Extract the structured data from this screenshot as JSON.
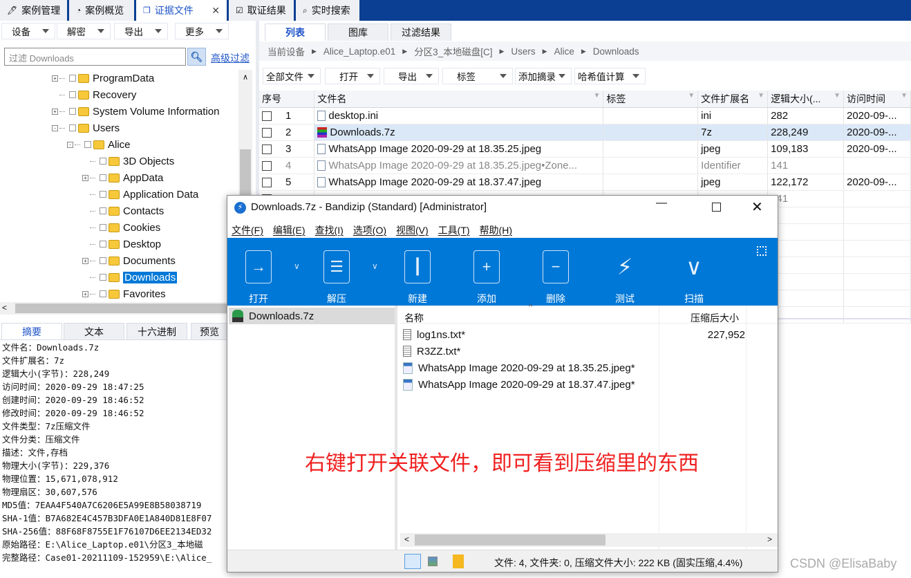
{
  "top_tabs": [
    {
      "label": "案例管理",
      "icon": "edit-icon"
    },
    {
      "label": "案例概览",
      "icon": "pie-icon"
    },
    {
      "label": "证据文件",
      "icon": "files-icon",
      "active": true
    },
    {
      "label": "取证结果",
      "icon": "checklist-icon"
    },
    {
      "label": "实时搜索",
      "icon": "search-icon"
    }
  ],
  "left_toolbar": [
    "设备",
    "解密",
    "导出",
    "更多"
  ],
  "filter": {
    "placeholder": "过滤 Downloads",
    "advanced": "高级过滤"
  },
  "tree": [
    {
      "label": "ProgramData",
      "exp": "+"
    },
    {
      "label": "Recovery",
      "exp": ""
    },
    {
      "label": "System Volume Information",
      "exp": "+"
    },
    {
      "label": "Users",
      "exp": "-"
    },
    {
      "label": "Alice",
      "exp": "-"
    },
    {
      "label": "3D Objects",
      "exp": ""
    },
    {
      "label": "AppData",
      "exp": "+"
    },
    {
      "label": "Application Data",
      "exp": ""
    },
    {
      "label": "Contacts",
      "exp": ""
    },
    {
      "label": "Cookies",
      "exp": ""
    },
    {
      "label": "Desktop",
      "exp": ""
    },
    {
      "label": "Documents",
      "exp": "+"
    },
    {
      "label": "Downloads",
      "exp": "",
      "selected": true
    },
    {
      "label": "Favorites",
      "exp": "+"
    }
  ],
  "right_tabs": [
    "列表",
    "图库",
    "过滤结果"
  ],
  "breadcrumb": [
    "当前设备",
    "Alice_Laptop.e01",
    "分区3_本地磁盘[C]",
    "Users",
    "Alice",
    "Downloads"
  ],
  "right_toolbar": [
    "全部文件",
    "打开",
    "导出",
    "标签",
    "添加摘录",
    "哈希值计算"
  ],
  "table": {
    "headers": [
      "序号",
      "文件名",
      "标签",
      "文件扩展名",
      "逻辑大小(...",
      "访问时间"
    ],
    "rows": [
      {
        "n": "1",
        "name": "desktop.ini",
        "tag": "",
        "ext": "ini",
        "size": "282",
        "time": "2020-09-..."
      },
      {
        "n": "2",
        "name": "Downloads.7z",
        "tag": "",
        "ext": "7z",
        "size": "228,249",
        "time": "2020-09-...",
        "selected": true
      },
      {
        "n": "3",
        "name": "WhatsApp Image 2020-09-29 at 18.35.25.jpeg",
        "tag": "",
        "ext": "jpeg",
        "size": "109,183",
        "time": "2020-09-..."
      },
      {
        "n": "4",
        "name": "WhatsApp Image 2020-09-29 at 18.35.25.jpeg•Zone...",
        "tag": "",
        "ext": "Identifier",
        "size": "141",
        "time": "",
        "dim": true
      },
      {
        "n": "5",
        "name": "WhatsApp Image 2020-09-29 at 18.37.47.jpeg",
        "tag": "",
        "ext": "jpeg",
        "size": "122,172",
        "time": "2020-09-..."
      },
      {
        "n": "",
        "name": "",
        "tag": "",
        "ext": "",
        "size": "141",
        "time": "",
        "dim": true
      }
    ]
  },
  "bottom_tabs": [
    "摘要",
    "文本",
    "十六进制",
    "预览"
  ],
  "summary": [
    "文件名：Downloads.7z",
    "文件扩展名：7z",
    "逻辑大小(字节)：228,249",
    "访问时间：2020-09-29 18:47:25",
    "创建时间：2020-09-29 18:46:52",
    "修改时间：2020-09-29 18:46:52",
    "文件类型：7z压缩文件",
    "文件分类：压缩文件",
    "描述：文件,存档",
    "物理大小(字节)：229,376",
    "物理位置：15,671,078,912",
    "物理扇区：30,607,576",
    "MD5值：7EAA4F540A7C6206E5A99E8B58038719",
    "SHA-1值：B7A682E4C457B3DFA0E1A840D81E8F07",
    "SHA-256值：88F68F8755E1F76107D6EE2134ED32",
    "原始路径：E:\\Alice_Laptop.e01\\分区3_本地磁",
    "完整路径：Case01-20211109-152959\\E:\\Alice_"
  ],
  "bandizip": {
    "title": "Downloads.7z - Bandizip (Standard) [Administrator]",
    "menu": [
      "文件(F)",
      "编辑(E)",
      "查找(I)",
      "选项(O)",
      "视图(V)",
      "工具(T)",
      "帮助(H)"
    ],
    "tools": [
      {
        "label": "打开",
        "icon": "open-icon"
      },
      {
        "label": "解压",
        "icon": "extract-icon"
      },
      {
        "label": "新建",
        "icon": "new-archive-icon"
      },
      {
        "label": "添加",
        "icon": "add-icon"
      },
      {
        "label": "删除",
        "icon": "delete-icon"
      },
      {
        "label": "测试",
        "icon": "test-icon"
      },
      {
        "label": "扫描",
        "icon": "scan-icon"
      }
    ],
    "accent": "#0078d7",
    "archive": "Downloads.7z",
    "headers": [
      "名称",
      "压缩后大小"
    ],
    "files": [
      {
        "name": "log1ns.txt*",
        "size": "227,952",
        "type": "txt"
      },
      {
        "name": "R3ZZ.txt*",
        "size": "",
        "type": "txt"
      },
      {
        "name": "WhatsApp Image 2020-09-29 at 18.35.25.jpeg*",
        "size": "",
        "type": "jpeg"
      },
      {
        "name": "WhatsApp Image 2020-09-29 at 18.37.47.jpeg*",
        "size": "",
        "type": "jpeg"
      }
    ],
    "status": "文件: 4, 文件夹: 0, 压缩文件大小: 222 KB (固实压缩,4.4%)"
  },
  "annotation": "右键打开关联文件，即可看到压缩里的东西",
  "watermark": "CSDN @ElisaBaby"
}
